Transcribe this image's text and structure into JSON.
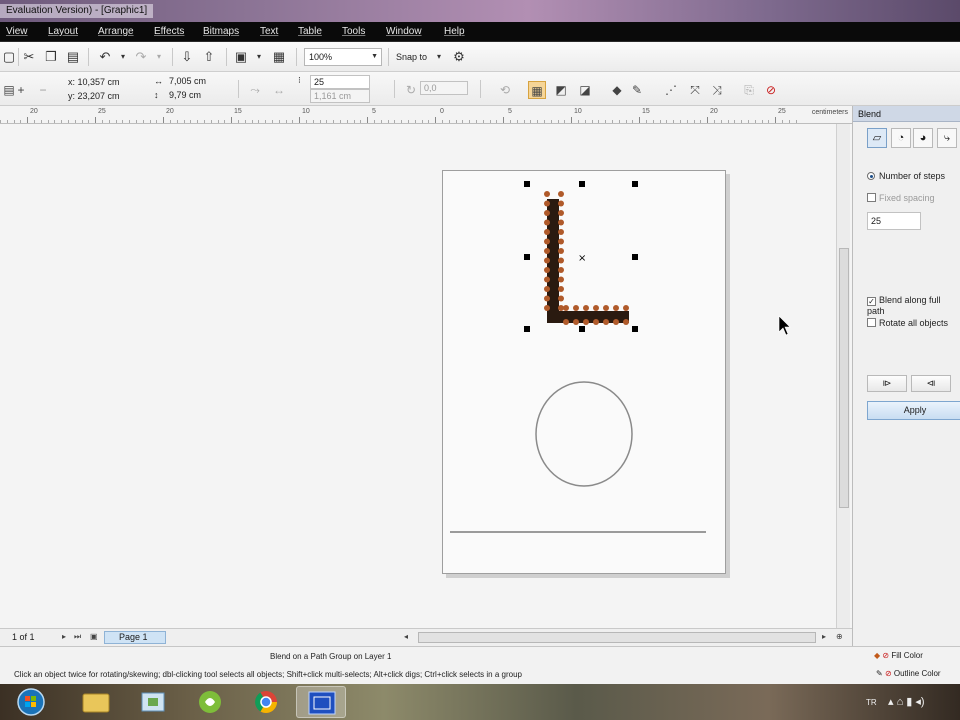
{
  "window": {
    "title": "Evaluation Version) - [Graphic1]"
  },
  "menu": [
    "View",
    "Layout",
    "Arrange",
    "Effects",
    "Bitmaps",
    "Text",
    "Table",
    "Tools",
    "Window",
    "Help"
  ],
  "toolbar": {
    "zoom": "100%",
    "snap_to": "Snap to"
  },
  "property_bar": {
    "x": "x: 10,357 cm",
    "y": "y: 23,207 cm",
    "width": "7,005 cm",
    "height": "9,79 cm",
    "steps": "25",
    "spacing": "1,161 cm",
    "rotation": "0,0"
  },
  "ruler": {
    "ticks": [
      "20",
      "25",
      "20",
      "15",
      "10",
      "5",
      "0",
      "5",
      "10",
      "15",
      "20",
      "25"
    ],
    "unit": "centimeters"
  },
  "docker": {
    "title": "Blend",
    "number_of_steps": "Number of steps",
    "fixed_spacing": "Fixed spacing",
    "steps_value": "25",
    "blend_along_full_path": "Blend along full path",
    "rotate_all_objects": "Rotate all objects",
    "apply": "Apply"
  },
  "page_nav": {
    "count": "1 of 1",
    "page_tab": "Page 1"
  },
  "status": {
    "line1": "Blend on a Path Group on Layer 1",
    "line2": "Click an object twice for rotating/skewing; dbl-clicking tool selects all objects; Shift+click multi-selects; Alt+click digs; Ctrl+click selects in a group",
    "fill_color": "Fill Color",
    "outline_color": "Outline Color"
  },
  "taskbar": {
    "lang": "TR"
  },
  "colors": {
    "menubar": "#0a0a0a",
    "accent": "#c8ddf2",
    "blend_node": "#b05a2a",
    "blend_fill": "#2a1a10"
  }
}
